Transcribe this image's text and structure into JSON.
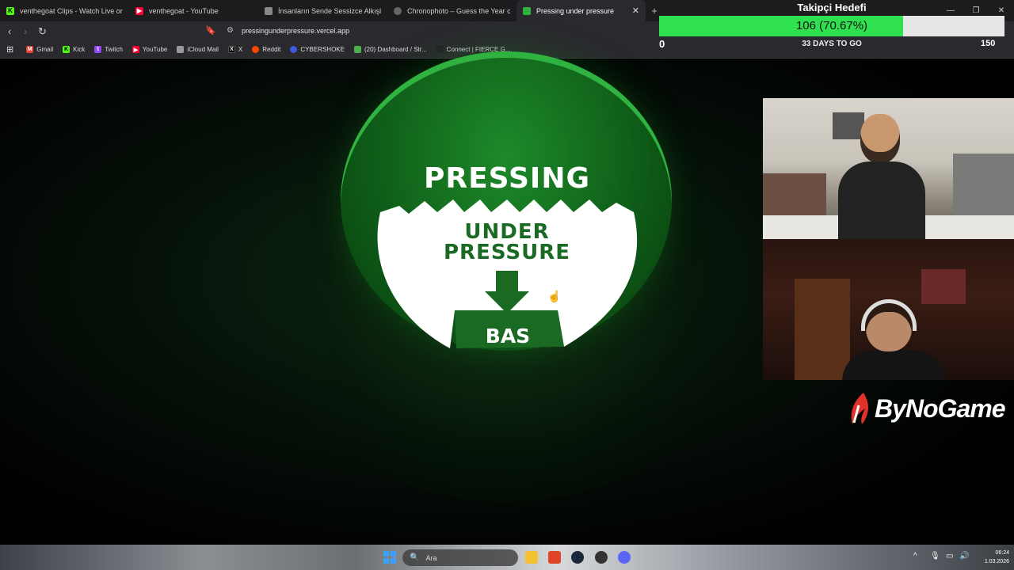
{
  "browser": {
    "tabs": [
      {
        "title": "venthegoat Clips - Watch Live on Kick",
        "icon": "kick-icon",
        "color": "#53fc18"
      },
      {
        "title": "venthegoat - YouTube",
        "icon": "youtube-icon",
        "color": "#ff0033"
      },
      {
        "title": "İnsanların Sende Sessizce Alkışladığı",
        "icon": "site-icon",
        "color": "#888888"
      },
      {
        "title": "Chronophoto – Guess the Year of the",
        "icon": "chronophoto-icon",
        "color": "#666666"
      },
      {
        "title": "Pressing under pressure",
        "icon": "page-icon",
        "color": "#2fb23f",
        "active": true
      }
    ],
    "url": "pressingunderpressure.vercel.app",
    "bookmarks": [
      {
        "label": "Gmail",
        "icon": "gmail-icon",
        "color": "#ea4335"
      },
      {
        "label": "Kick",
        "icon": "kick-icon",
        "color": "#53fc18"
      },
      {
        "label": "Twitch",
        "icon": "twitch-icon",
        "color": "#9146ff"
      },
      {
        "label": "YouTube",
        "icon": "youtube-icon",
        "color": "#ff0033"
      },
      {
        "label": "iCloud Mail",
        "icon": "apple-icon",
        "color": "#999999"
      },
      {
        "label": "X",
        "icon": "x-icon",
        "color": "#000000"
      },
      {
        "label": "Reddit",
        "icon": "reddit-icon",
        "color": "#ff4500"
      },
      {
        "label": "CYBERSHOKE",
        "icon": "cybershoke-icon",
        "color": "#3b5bdb"
      },
      {
        "label": "(20) Dashboard / Str...",
        "icon": "dashboard-icon",
        "color": "#4caf50"
      },
      {
        "label": "Connect | FIERCE G...",
        "icon": "fierce-icon",
        "color": "#222222"
      }
    ]
  },
  "game": {
    "title": "PRESSING",
    "subtitle_line1": "UNDER",
    "subtitle_line2": "PRESSURE",
    "button_label": "BAS"
  },
  "follower_goal": {
    "title": "Takipçi Hedefi",
    "current": 106,
    "target": 150,
    "progress": 0.7067,
    "value_text": "106 (70.67%)",
    "min_label": "0",
    "max_label": "150",
    "days_text": "33 DAYS TO GO",
    "fill_color": "#2fe04f"
  },
  "brand": {
    "name": "ByNoGame",
    "accent": "#e0322a"
  },
  "taskbar": {
    "search_placeholder": "Ara",
    "time": "06:24",
    "date": "1.03.2026"
  }
}
